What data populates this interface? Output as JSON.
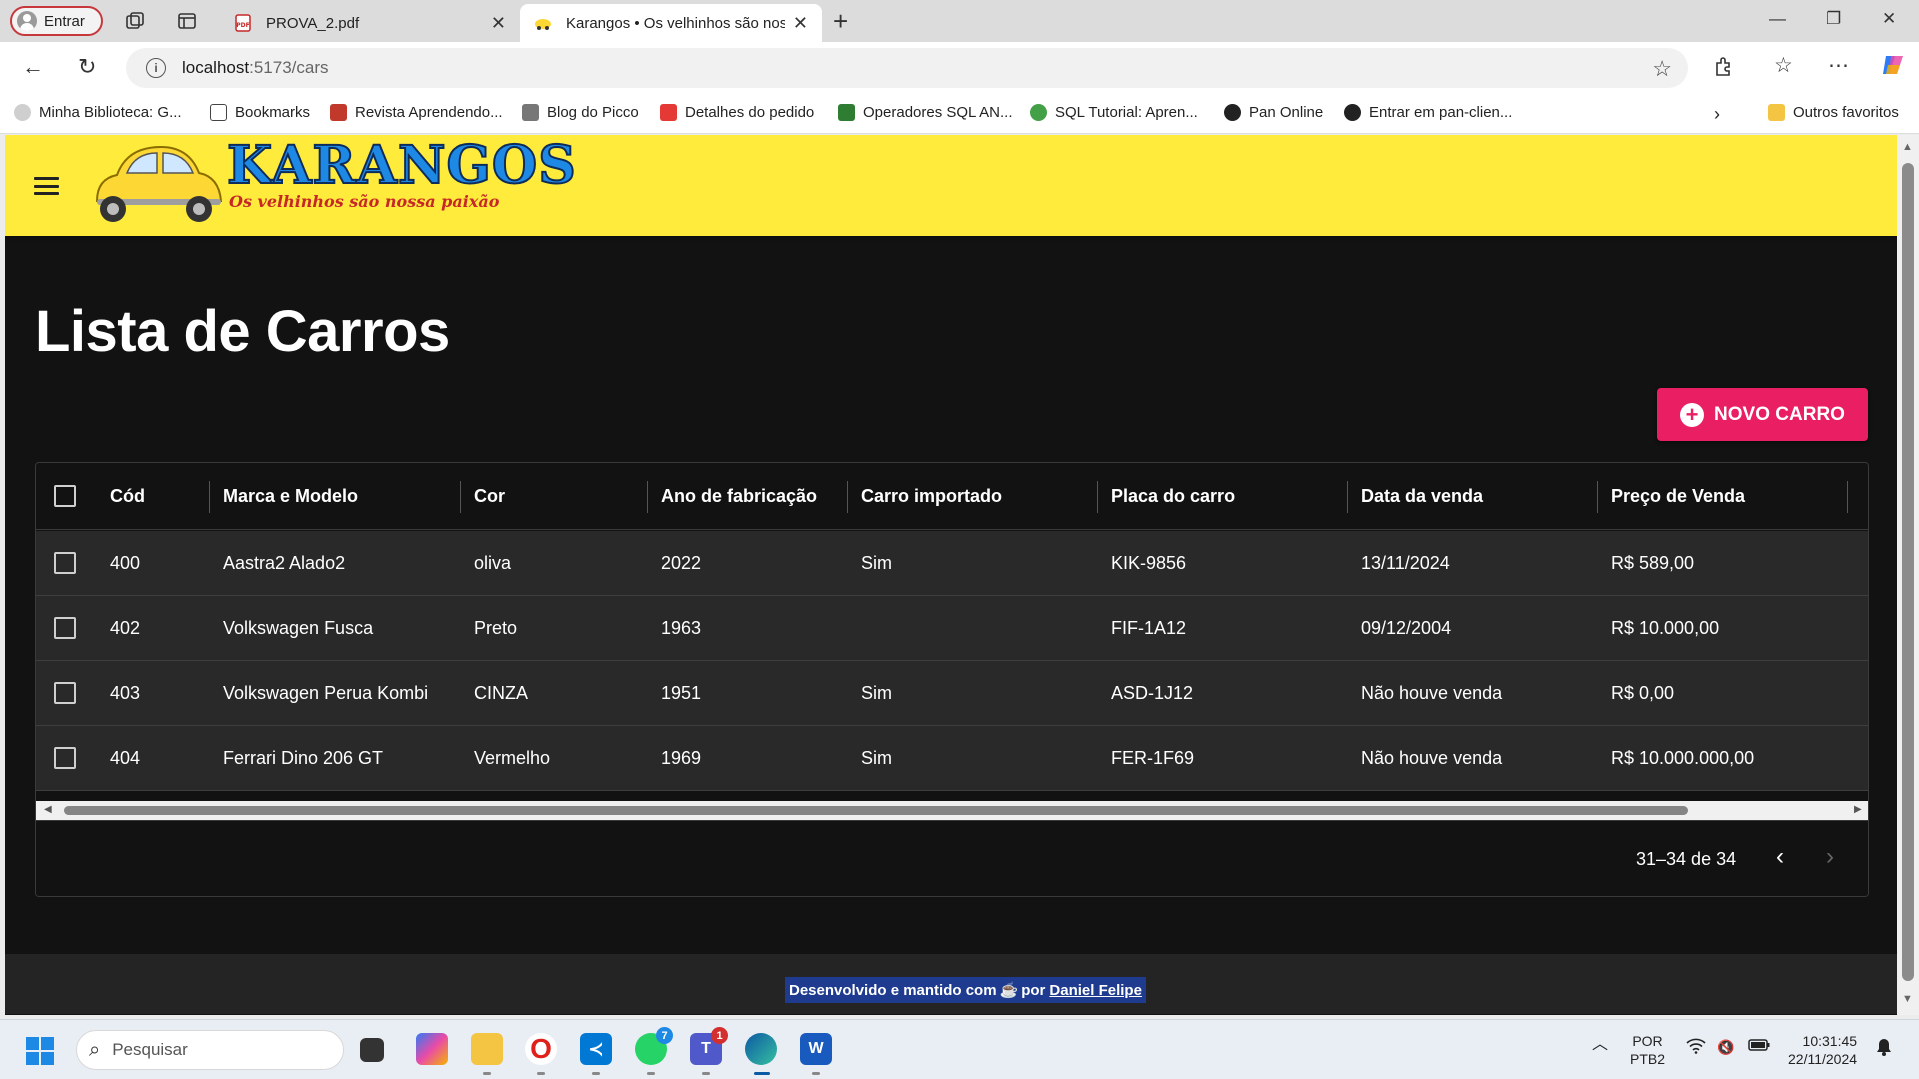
{
  "browser": {
    "profile_label": "Entrar",
    "tabs": [
      {
        "title": "PROVA_2.pdf",
        "active": false
      },
      {
        "title": "Karangos • Os velhinhos são nossa paixão",
        "active": true
      }
    ],
    "url_host": "localhost",
    "url_path": ":5173/cars",
    "bookmarks": [
      {
        "label": "Minha Biblioteca: G...",
        "icon_color": "#cfcfcf"
      },
      {
        "label": "Bookmarks",
        "icon_color": "#ffffff"
      },
      {
        "label": "Revista Aprendendo...",
        "icon_color": "#c0392b"
      },
      {
        "label": "Blog do Picco",
        "icon_color": "#777777"
      },
      {
        "label": "Detalhes do pedido",
        "icon_color": "#e53935"
      },
      {
        "label": "Operadores SQL AN...",
        "icon_color": "#2e7d32"
      },
      {
        "label": "SQL Tutorial: Apren...",
        "icon_color": "#43a047"
      },
      {
        "label": "Pan Online",
        "icon_color": "#222222"
      },
      {
        "label": "Entrar em pan-clien...",
        "icon_color": "#222222"
      }
    ],
    "other_favorites": "Outros favoritos"
  },
  "app": {
    "logo_title": "KARANGOS",
    "logo_subtitle": "Os velhinhos são nossa paixão",
    "page_title": "Lista de Carros",
    "new_button_label": "NOVO CARRO",
    "columns": [
      "Cód",
      "Marca e Modelo",
      "Cor",
      "Ano de fabricação",
      "Carro importado",
      "Placa do carro",
      "Data da venda",
      "Preço de Venda"
    ],
    "rows": [
      {
        "id": "400",
        "model": "Aastra2 Alado2",
        "color": "oliva",
        "year": "2022",
        "imported": "Sim",
        "plate": "KIK-9856",
        "sale_date": "13/11/2024",
        "price": "R$ 589,00"
      },
      {
        "id": "402",
        "model": "Volkswagen Fusca",
        "color": "Preto",
        "year": "1963",
        "imported": "",
        "plate": "FIF-1A12",
        "sale_date": "09/12/2004",
        "price": "R$ 10.000,00"
      },
      {
        "id": "403",
        "model": "Volkswagen Perua Kombi",
        "color": "CINZA",
        "year": "1951",
        "imported": "Sim",
        "plate": "ASD-1J12",
        "sale_date": "Não houve venda",
        "price": "R$ 0,00"
      },
      {
        "id": "404",
        "model": "Ferrari Dino 206 GT",
        "color": "Vermelho",
        "year": "1969",
        "imported": "Sim",
        "plate": "FER-1F69",
        "sale_date": "Não houve venda",
        "price": "R$ 10.000.000,00"
      }
    ],
    "pagination": "31–34 de 34",
    "footer_text": "Desenvolvido e mantido com",
    "footer_by": "por",
    "footer_author": "Daniel Felipe",
    "accent_color": "#e91e63",
    "appbar_color": "#ffeb3b"
  },
  "taskbar": {
    "search_placeholder": "Pesquisar",
    "whatsapp_badge": "7",
    "teams_badge": "1",
    "language": "POR",
    "layout": "PTB2",
    "time": "10:31:45",
    "date": "22/11/2024"
  }
}
